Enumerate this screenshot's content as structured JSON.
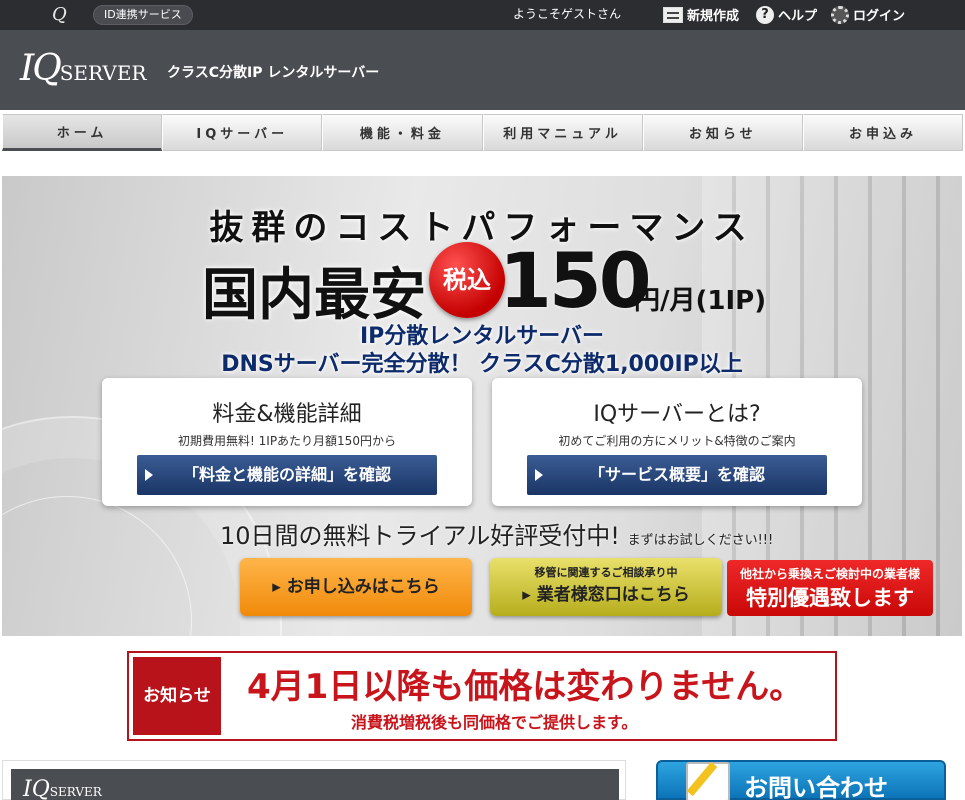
{
  "topbar": {
    "logo_glyph": "Q",
    "id_service": "ID連携サービス",
    "welcome": "ようこそゲストさん",
    "new_account": "新規作成",
    "help": "ヘルプ",
    "login": "ログイン"
  },
  "header": {
    "logo_iq": "IQ",
    "logo_server": "SERVER",
    "tagline": "クラスC分散IP レンタルサーバー"
  },
  "nav": {
    "items": [
      {
        "label": "ホーム"
      },
      {
        "label": "IQサーバー"
      },
      {
        "label": "機能・料金"
      },
      {
        "label": "利用マニュアル"
      },
      {
        "label": "お知らせ"
      },
      {
        "label": "お申込み"
      }
    ]
  },
  "hero": {
    "title": "抜群のコストパフォーマンス",
    "cheapest": "国内最安",
    "tax_badge": "税込",
    "price": "150",
    "price_unit": "円/月(1IP)",
    "sub1": "IP分散レンタルサーバー",
    "sub2": "DNSサーバー完全分散！ クラスC分散1,000IP以上",
    "card_left": {
      "heading": "料金&機能詳細",
      "text": "初期費用無料! 1IPあたり月額150円から",
      "button": "「料金と機能の詳細」を確認"
    },
    "card_right": {
      "heading": "IQサーバーとは?",
      "text": "初めてご利用の方にメリット&特徴のご案内",
      "button": "「サービス概要」を確認"
    },
    "trial": "10日間の無料トライアル好評受付中!",
    "trial_small": "まずはお試しください!!!",
    "apply_button": "▸ お申し込みはこちら",
    "dealer_pre": "移管に関連するご相談承り中",
    "dealer_main": "▸ 業者様窓口はこちら",
    "special_pre": "他社から乗換えご検討中の業者様",
    "special_main": "特別優遇致します"
  },
  "notice": {
    "tag": "お知らせ",
    "main": "4月1日以降も価格は変わりません。",
    "sub": "消費税増税後も同価格でご提供します。"
  },
  "bottom": {
    "logo_iq": "IQ",
    "logo_server": "SERVER",
    "contact": "お問い合わせ"
  }
}
